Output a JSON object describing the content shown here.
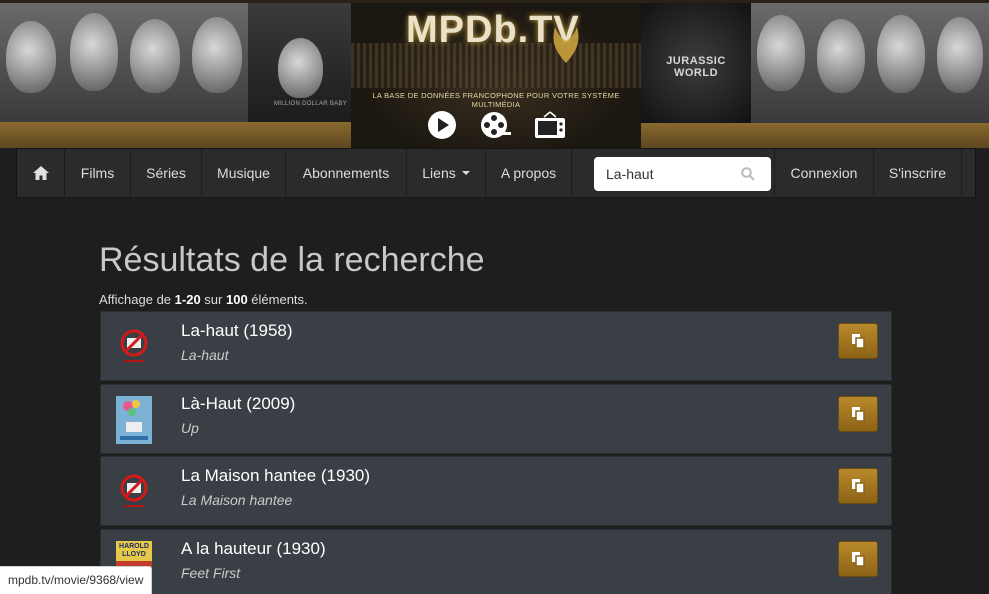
{
  "banner": {
    "logo_title": "MPDb.TV",
    "tagline": "LA BASE DE DONNÉES FRANCOPHONE POUR VOTRE SYSTÈME MULTIMÉDIA",
    "icons": [
      "play-icon",
      "film-reel-icon",
      "tv-icon"
    ],
    "poster_label_left": "MILLION DOLLAR BABY",
    "poster_label_right": "JURASSIC WORLD"
  },
  "navbar": {
    "home_icon": "home-icon",
    "items": {
      "films": "Films",
      "series": "Séries",
      "musique": "Musique",
      "abonnements": "Abonnements",
      "liens": "Liens",
      "apropos": "A propos"
    },
    "search_value": "La-haut",
    "search_icon": "search-icon",
    "connexion": "Connexion",
    "inscrire": "S'inscrire"
  },
  "main": {
    "title": "Résultats de la recherche",
    "summary": {
      "prefix": "Affichage de ",
      "range": "1-20",
      "middle": " sur ",
      "total": "100",
      "suffix": " éléments."
    },
    "results": [
      {
        "title": "La-haut (1958)",
        "subtitle": "La-haut",
        "thumb": "no-image-icon"
      },
      {
        "title": "Là-Haut (2009)",
        "subtitle": "Up",
        "thumb": "poster-thumbnail"
      },
      {
        "title": "La Maison hantee (1930)",
        "subtitle": "La Maison hantee",
        "thumb": "no-image-icon"
      },
      {
        "title": "A la hauteur (1930)",
        "subtitle": "Feet First",
        "thumb": "poster-thumbnail",
        "poster_text": "HAROLD LLOYD"
      }
    ]
  },
  "status_bar": {
    "url": "mpdb.tv/movie/9368/view"
  },
  "colors": {
    "accent": "#a77a22",
    "row_bg": "#3a3f45",
    "page_bg": "#1e1e1e",
    "nav_bg": "#2b2b2b"
  }
}
